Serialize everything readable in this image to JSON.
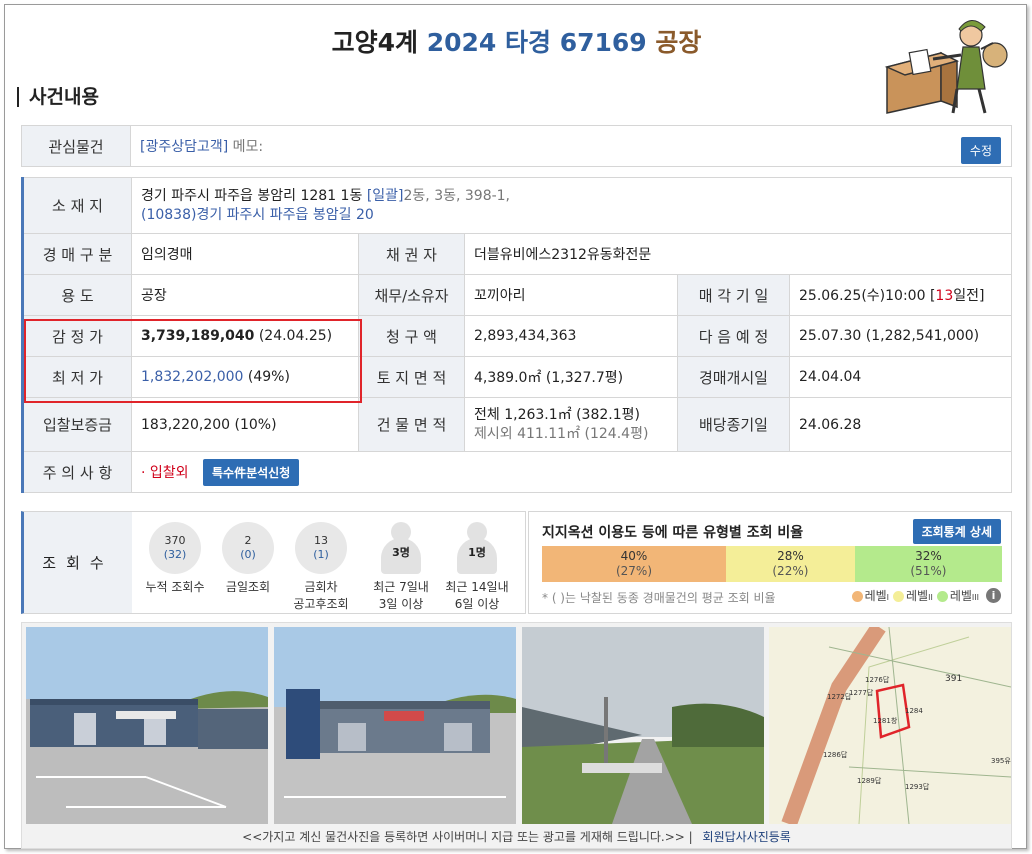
{
  "header": {
    "court": "고양4계",
    "case_no": "2024 타경 67169",
    "type": "공장"
  },
  "section_title": "사건내용",
  "interest": {
    "label": "관심물건",
    "tag": "[광주상담고객]",
    "memo_label": "메모:",
    "edit_button": "수정"
  },
  "info": {
    "location": {
      "label": "소 재 지",
      "line1": "경기 파주시 파주읍 봉암리 1281 1동",
      "line1_tag": "[일괄]",
      "line1_extra": "2동, 3동, 398-1,",
      "line2": "(10838)경기 파주시  파주읍 봉암길  20"
    },
    "auction_type": {
      "label": "경 매 구 분",
      "value": "임의경매"
    },
    "creditor": {
      "label": "채   권   자",
      "value": "더블유비에스2312유동화전문"
    },
    "usage": {
      "label": "용        도",
      "value": "공장"
    },
    "debtor": {
      "label": "채무/소유자",
      "value": "꼬끼아리"
    },
    "sale_date": {
      "label": "매 각 기 일",
      "value_pre": "25.06.25(수)10:00 [",
      "days": "13",
      "value_post": "일전]"
    },
    "appraisal": {
      "label": "감 정 가",
      "amount": "3,739,189,040",
      "date": "(24.04.25)"
    },
    "claim": {
      "label": "청   구   액",
      "value": "2,893,434,363"
    },
    "next_schedule": {
      "label": "다 음 예 정",
      "value": "25.07.30 (1,282,541,000)"
    },
    "minimum": {
      "label": "최 저 가",
      "amount": "1,832,202,000",
      "pct": "(49%)"
    },
    "land_area": {
      "label": "토 지 면 적",
      "value": "4,389.0㎡ (1,327.7평)"
    },
    "auction_start": {
      "label": "경매개시일",
      "value": "24.04.04"
    },
    "deposit": {
      "label": "입찰보증금",
      "value": "183,220,200 (10%)"
    },
    "building_area": {
      "label": "건 물 면 적",
      "line1": "전체 1,263.1㎡ (382.1평)",
      "line2": "제시외 411.11㎡ (124.4평)"
    },
    "dividend": {
      "label": "배당종기일",
      "value": "24.06.28"
    },
    "notes": {
      "label": "주 의 사 항",
      "value": "· 입찰외",
      "button": "특수件분석신청"
    }
  },
  "views": {
    "label": "조회수",
    "stats": [
      {
        "num": "370",
        "sub": "(32)",
        "caption": "누적 조회수"
      },
      {
        "num": "2",
        "sub": "(0)",
        "caption": "금일조회"
      },
      {
        "num": "13",
        "sub": "(1)",
        "caption1": "금회차",
        "caption2": "공고후조회"
      }
    ],
    "people": [
      {
        "count": "3명",
        "caption1": "최근 7일내",
        "caption2": "3일 이상"
      },
      {
        "count": "1명",
        "caption1": "최근 14일내",
        "caption2": "6일 이상"
      }
    ]
  },
  "ratio": {
    "title": "지지옥션 이용도 등에 따른 유형별 조회 비율",
    "button": "조회통계 상세",
    "bars": [
      {
        "pct": "40%",
        "sub": "(27%)",
        "color": "#f2b677",
        "weight": 40
      },
      {
        "pct": "28%",
        "sub": "(22%)",
        "color": "#f4ee98",
        "weight": 28
      },
      {
        "pct": "32%",
        "sub": "(51%)",
        "color": "#b4ea8c",
        "weight": 32
      }
    ],
    "note": "* ( )는 낙찰된 동종 경매물건의 평균 조회 비율",
    "legend": [
      {
        "label": "레벨",
        "mark": "I",
        "color": "#f2b677"
      },
      {
        "label": "레벨",
        "mark": "II",
        "color": "#f4ee98"
      },
      {
        "label": "레벨",
        "mark": "III",
        "color": "#b4ea8c"
      }
    ]
  },
  "photos": {
    "footer_text": "<<가지고 계신 물건사진을 등록하면 사이버머니 지급 또는 광고를 게재해 드립니다.>>",
    "footer_sep": "|",
    "footer_link": "회원답사사진등록",
    "map_labels": [
      "1276답",
      "1277답",
      "1272답",
      "1281창",
      "1284",
      "391",
      "1286답",
      "1289답",
      "1293답",
      "395유"
    ]
  }
}
